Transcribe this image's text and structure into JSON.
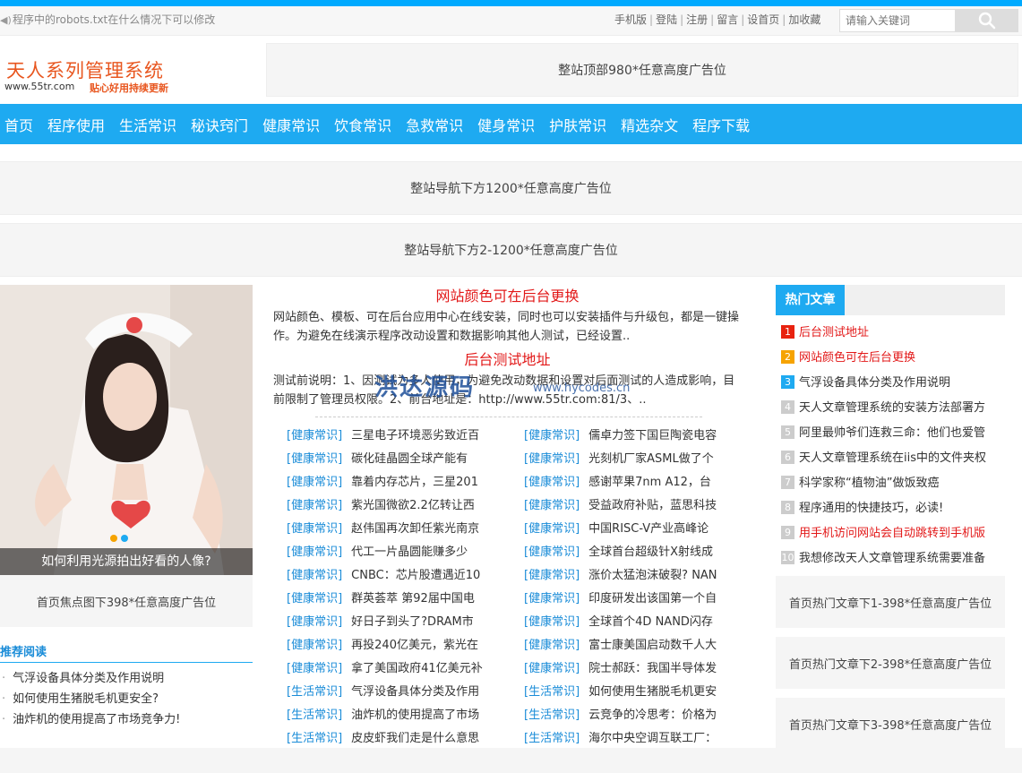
{
  "top_notice": "程序中的robots.txt在什么情况下可以修改",
  "top_links": [
    "手机版",
    "登陆",
    "注册",
    "留言",
    "设首页",
    "加收藏"
  ],
  "search": {
    "placeholder": "请输入关键词"
  },
  "logo": {
    "title": "天人系列管理系统",
    "url": "www.55tr.com",
    "slogan": "贴心好用持续更新"
  },
  "ads": {
    "top": "整站顶部980*任意高度广告位",
    "below_nav_1": "整站导航下方1200*任意高度广告位",
    "below_nav_2": "整站导航下方2-1200*任意高度广告位",
    "below_focus": "首页焦点图下398*任意高度广告位",
    "hot_1": "首页热门文章下1-398*任意高度广告位",
    "hot_2": "首页热门文章下2-398*任意高度广告位",
    "hot_3": "首页热门文章下3-398*任意高度广告位"
  },
  "nav": [
    "首页",
    "程序使用",
    "生活常识",
    "秘诀窍门",
    "健康常识",
    "饮食常识",
    "急救常识",
    "健身常识",
    "护肤常识",
    "精选杂文",
    "程序下载"
  ],
  "focus": {
    "caption": "如何利用光源拍出好看的人像?"
  },
  "recommended": {
    "title": "推荐阅读",
    "items": [
      "气浮设备具体分类及作用说明",
      "如何使用生猪脱毛机更安全?",
      "油炸机的使用提高了市场竞争力!"
    ]
  },
  "headlines": [
    {
      "title": "网站颜色可在后台更换",
      "summary": "网站颜色、模板、可在后台应用中心在线安装，同时也可以安装插件与升级包，都是一键操作。为避免在线演示程序改动设置和数据影响其他人测试，已经设置.."
    },
    {
      "title": "后台测试地址",
      "summary": "测试前说明：1、因测试为多人使用，为避免改动数据和设置对后面测试的人造成影响，目前限制了管理员权限。2、前台地址是：http://www.55tr.com:81/3、.."
    }
  ],
  "articles_left": [
    {
      "tag": "[健康常识]",
      "title": "三星电子环境恶劣致近百"
    },
    {
      "tag": "[健康常识]",
      "title": "碳化硅晶圆全球产能有"
    },
    {
      "tag": "[健康常识]",
      "title": "靠着内存芯片，三星201"
    },
    {
      "tag": "[健康常识]",
      "title": "紫光国微欲2.2亿转让西"
    },
    {
      "tag": "[健康常识]",
      "title": "赵伟国再次卸任紫光南京"
    },
    {
      "tag": "[健康常识]",
      "title": "代工一片晶圆能赚多少"
    },
    {
      "tag": "[健康常识]",
      "title": "CNBC：芯片股遭遇近10"
    },
    {
      "tag": "[健康常识]",
      "title": "群英荟萃 第92届中国电"
    },
    {
      "tag": "[健康常识]",
      "title": "好日子到头了?DRAM市"
    },
    {
      "tag": "[健康常识]",
      "title": "再投240亿美元，紫光在"
    },
    {
      "tag": "[健康常识]",
      "title": "拿了美国政府41亿美元补"
    },
    {
      "tag": "[生活常识]",
      "title": "气浮设备具体分类及作用"
    },
    {
      "tag": "[生活常识]",
      "title": "油炸机的使用提高了市场"
    },
    {
      "tag": "[生活常识]",
      "title": "皮皮虾我们走是什么意思"
    }
  ],
  "articles_right": [
    {
      "tag": "[健康常识]",
      "title": "儒卓力签下国巨陶瓷电容"
    },
    {
      "tag": "[健康常识]",
      "title": "光刻机厂家ASML做了个"
    },
    {
      "tag": "[健康常识]",
      "title": "感谢苹果7nm A12，台"
    },
    {
      "tag": "[健康常识]",
      "title": "受益政府补贴，蓝思科技"
    },
    {
      "tag": "[健康常识]",
      "title": "中国RISC-V产业高峰论"
    },
    {
      "tag": "[健康常识]",
      "title": "全球首台超级针X射线成"
    },
    {
      "tag": "[健康常识]",
      "title": "涨价太猛泡沫破裂? NAN"
    },
    {
      "tag": "[健康常识]",
      "title": "印度研发出该国第一个自"
    },
    {
      "tag": "[健康常识]",
      "title": "全球首个4D NAND闪存"
    },
    {
      "tag": "[健康常识]",
      "title": "富士康美国启动数千人大"
    },
    {
      "tag": "[健康常识]",
      "title": "院士郝跃：我国半导体发"
    },
    {
      "tag": "[生活常识]",
      "title": "如何使用生猪脱毛机更安"
    },
    {
      "tag": "[生活常识]",
      "title": "云竞争的冷思考：价格为"
    },
    {
      "tag": "[生活常识]",
      "title": "海尔中央空调互联工厂："
    }
  ],
  "hot": {
    "title": "热门文章",
    "items": [
      {
        "num": "1",
        "title": "后台测试地址",
        "num_color": "#e8220f",
        "text_color": "#e21818"
      },
      {
        "num": "2",
        "title": "网站颜色可在后台更换",
        "num_color": "#f6a300",
        "text_color": "#e21818"
      },
      {
        "num": "3",
        "title": "气浮设备具体分类及作用说明",
        "num_color": "#1eaaf1",
        "text_color": "#333333"
      },
      {
        "num": "4",
        "title": "天人文章管理系统的安装方法部署方",
        "num_color": "#cccccc",
        "text_color": "#333333"
      },
      {
        "num": "5",
        "title": "阿里最帅爷们连救三命：他们也爱管",
        "num_color": "#cccccc",
        "text_color": "#333333"
      },
      {
        "num": "6",
        "title": "天人文章管理系统在iis中的文件夹权",
        "num_color": "#cccccc",
        "text_color": "#333333"
      },
      {
        "num": "7",
        "title": "科学家称“植物油”做饭致癌",
        "num_color": "#cccccc",
        "text_color": "#333333"
      },
      {
        "num": "8",
        "title": "程序通用的快捷技巧，必读!",
        "num_color": "#cccccc",
        "text_color": "#333333"
      },
      {
        "num": "9",
        "title": "用手机访问网站会自动跳转到手机版",
        "num_color": "#cccccc",
        "text_color": "#e21818"
      },
      {
        "num": "10",
        "title": "我想修改天人文章管理系统需要准备",
        "num_color": "#cccccc",
        "text_color": "#333333"
      }
    ]
  },
  "watermark": {
    "cn": "洪达源码",
    "en": "www.hycodes.cn"
  },
  "colors": {
    "accent": "#1eaaf1",
    "logo": "#e8561f",
    "headline": "#e21818",
    "tag": "#1a8cd8"
  }
}
